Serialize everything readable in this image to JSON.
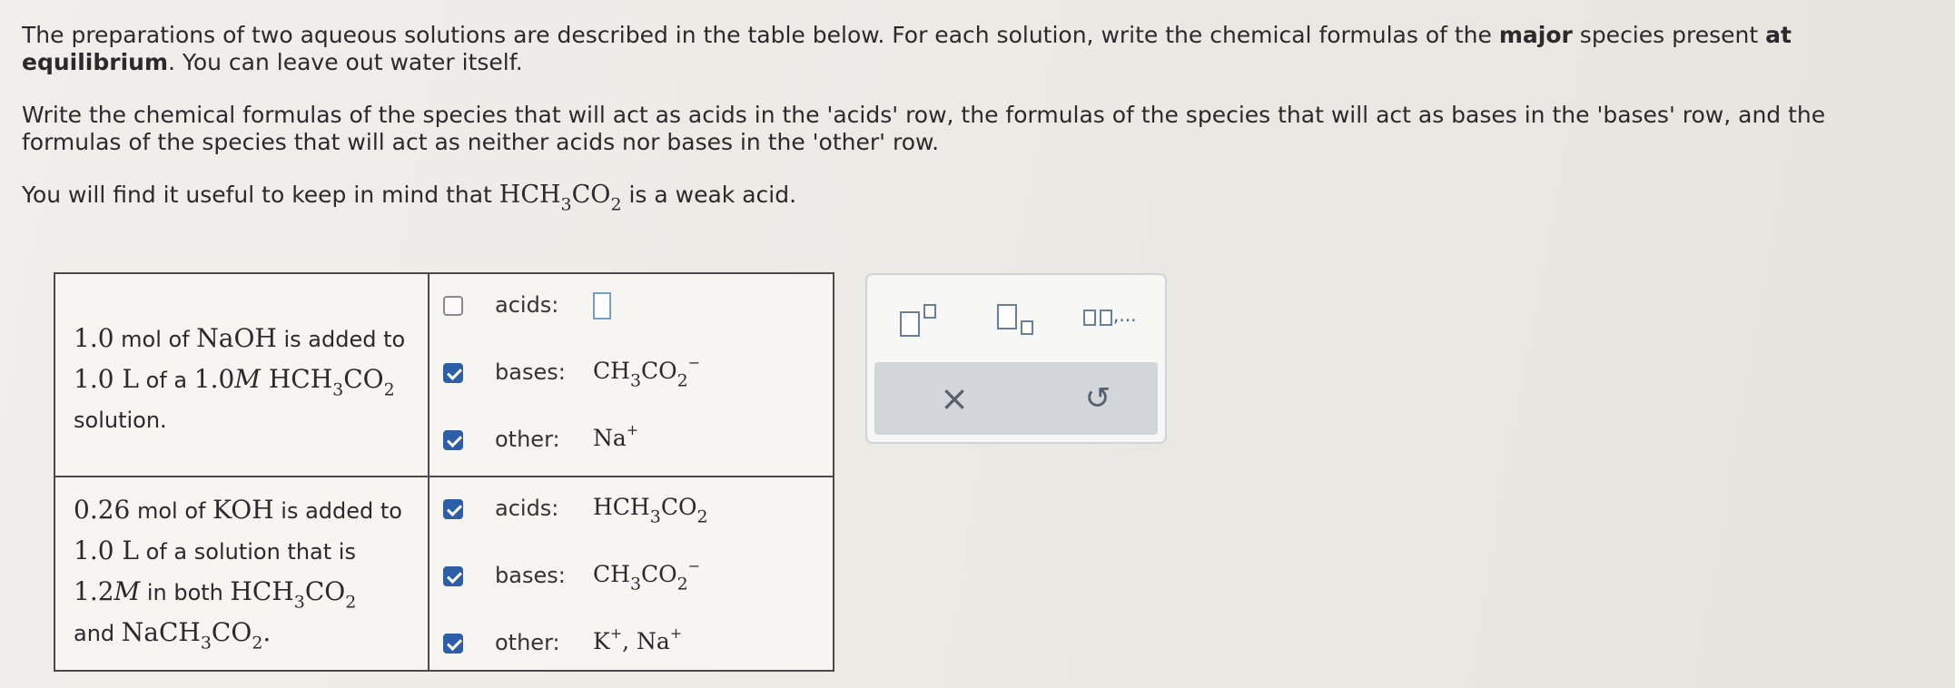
{
  "instructions": {
    "p1_a": "The preparations of two aqueous solutions are described in the table below. For each solution, write the chemical formulas of the ",
    "p1_b": "major",
    "p1_c": " species present ",
    "p1_d": "at equilibrium",
    "p1_e": ". You can leave out water itself.",
    "p2": "Write the chemical formulas of the species that will act as acids in the 'acids' row, the formulas of the species that will act as bases in the 'bases' row, and the formulas of the species that will act as neither acids nor bases in the 'other' row.",
    "p3_a": "You will find it useful to keep in mind that ",
    "p3_b": " is a weak acid."
  },
  "rows": [
    {
      "description": {
        "t1": "1.0",
        "t2": " mol of ",
        "t3": "NaOH",
        "t4": " is added to",
        "t5": "1.0 L",
        "t6": " of a ",
        "t7": "1.0",
        "t8": "M",
        "t9": " solution."
      },
      "responses": [
        {
          "label": "acids:",
          "checked": false,
          "value": ""
        },
        {
          "label": "bases:",
          "checked": true
        },
        {
          "label": "other:",
          "checked": true,
          "value": "Na"
        }
      ]
    },
    {
      "description": {
        "t1": "0.26",
        "t2": " mol of ",
        "t3": "KOH",
        "t4": " is added to",
        "t5": "1.0 L",
        "t6": " of a solution that is",
        "t7": "1.2",
        "t8": "M",
        "t9": " in both ",
        "t10": "and "
      },
      "responses": [
        {
          "label": "acids:",
          "checked": true
        },
        {
          "label": "bases:",
          "checked": true
        },
        {
          "label": "other:",
          "checked": true,
          "value_k": "K",
          "value_na": "Na"
        }
      ]
    }
  ],
  "toolbar": {
    "superscript_icon": "superscript-icon",
    "subscript_icon": "subscript-icon",
    "list_icon": "list-icon",
    "list_suffix": ",...",
    "clear_label": "×",
    "undo_label": "↺"
  }
}
